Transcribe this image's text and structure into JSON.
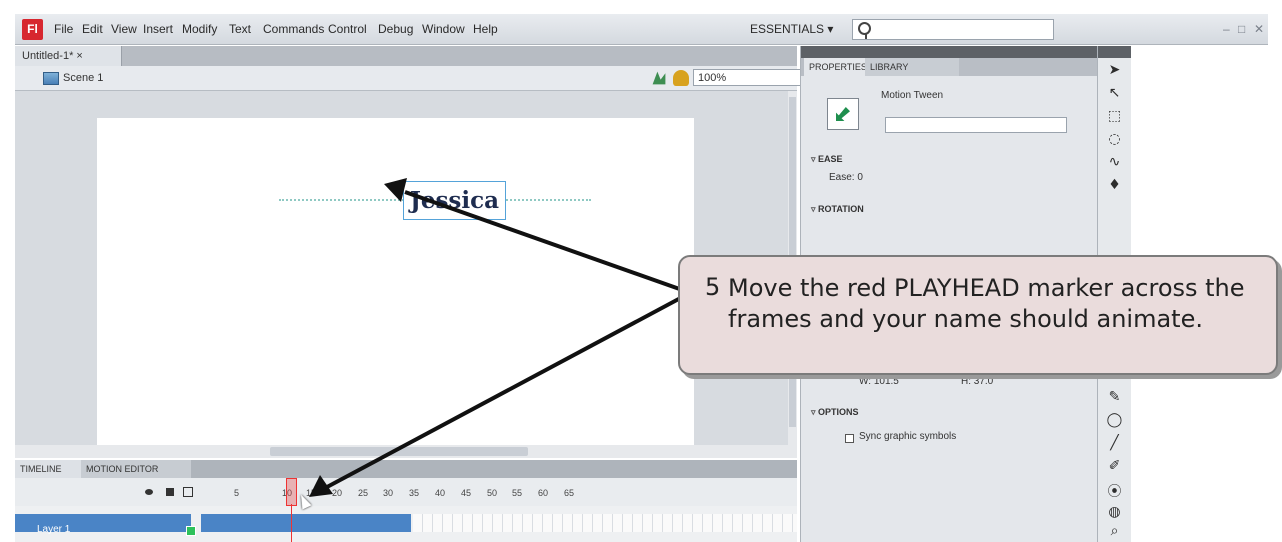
{
  "menubar": {
    "app_icon": "Fl",
    "items": [
      "File",
      "Edit",
      "View",
      "Insert",
      "Modify",
      "Text",
      "Commands",
      "Control",
      "Debug",
      "Window",
      "Help"
    ],
    "workspace": "ESSENTIALS ▾",
    "window_controls": [
      "–",
      "□",
      "✕"
    ]
  },
  "document": {
    "tab": "Untitled-1* ×",
    "scene": "Scene 1",
    "zoom": "100%",
    "stage_text": "Jessica"
  },
  "timeline": {
    "tabs": [
      "TIMELINE",
      "MOTION EDITOR"
    ],
    "ruler": [
      "5",
      "10",
      "15",
      "20",
      "25",
      "30",
      "35",
      "40",
      "45",
      "50",
      "55",
      "60",
      "65"
    ],
    "layer_name": "Layer 1"
  },
  "properties": {
    "tabs": [
      "PROPERTIES",
      "LIBRARY"
    ],
    "tween_label": "Motion Tween",
    "sections": {
      "ease": "EASE",
      "ease_label": "Ease: 0",
      "rotation": "ROTATION",
      "size_w": "W: 101.5",
      "size_h": "H: 37.0",
      "options": "OPTIONS",
      "sync_label": "Sync graphic symbols"
    }
  },
  "tools": [
    "➤",
    "↖",
    "⬚",
    "◌",
    "∿",
    "♦",
    "✎",
    "◯",
    "╱",
    "✐",
    "⦿",
    "◍",
    "⌕"
  ],
  "callout": {
    "step": "5",
    "text": "Move the red PLAYHEAD marker across the frames and your name should animate."
  },
  "colors": {
    "callout_bg": "#eadcdc",
    "playhead": "#e33333",
    "layer_selected": "#4a84c6",
    "app_icon": "#d7272f"
  }
}
